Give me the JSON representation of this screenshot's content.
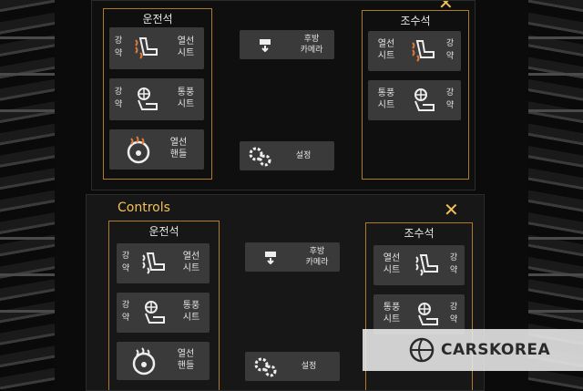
{
  "colors": {
    "accent": "#f2c15a",
    "panel_border": "#b07a2a",
    "button_bg": "#3a3a3a",
    "heat": "#e0793a"
  },
  "top": {
    "driver_title": "운전석",
    "passenger_title": "조수석",
    "driver": {
      "seat_heat": {
        "level_high": "강",
        "level_low": "약",
        "label_line1": "열선",
        "label_line2": "시트",
        "icon": "heated-seat-icon"
      },
      "seat_vent": {
        "level_high": "강",
        "level_low": "약",
        "label_line1": "통풍",
        "label_line2": "시트",
        "icon": "ventilated-seat-icon"
      },
      "wheel_heat": {
        "label_line1": "열선",
        "label_line2": "핸들",
        "icon": "heated-wheel-icon"
      }
    },
    "passenger": {
      "seat_heat": {
        "level_high": "강",
        "level_low": "약",
        "label_line1": "열선",
        "label_line2": "시트",
        "icon": "heated-seat-icon"
      },
      "seat_vent": {
        "level_high": "강",
        "level_low": "약",
        "label_line1": "통풍",
        "label_line2": "시트",
        "icon": "ventilated-seat-icon"
      }
    },
    "rear_camera": {
      "label_line1": "후방",
      "label_line2": "카메라",
      "icon": "camera-icon"
    },
    "settings": {
      "label": "설정",
      "icon": "gears-icon"
    }
  },
  "bottom": {
    "title": "Controls",
    "close_icon": "close-icon",
    "driver_title": "운전석",
    "passenger_title": "조수석",
    "driver": {
      "seat_heat": {
        "level_high": "강",
        "level_low": "약",
        "label_line1": "열선",
        "label_line2": "시트"
      },
      "seat_vent": {
        "level_high": "강",
        "level_low": "약",
        "label_line1": "통풍",
        "label_line2": "시트"
      },
      "wheel_heat": {
        "label_line1": "열선",
        "label_line2": "핸들"
      }
    },
    "passenger": {
      "seat_heat": {
        "level_high": "강",
        "level_low": "약",
        "label_line1": "열선",
        "label_line2": "시트"
      },
      "seat_vent": {
        "level_high": "강",
        "level_low": "약",
        "label_line1": "통풍",
        "label_line2": "시트"
      }
    },
    "rear_camera": {
      "label_line1": "후방",
      "label_line2": "카메라"
    },
    "settings": {
      "label": "설정"
    }
  },
  "watermark": {
    "text": "CARSKOREA",
    "icon": "carskorea-logo-icon"
  }
}
